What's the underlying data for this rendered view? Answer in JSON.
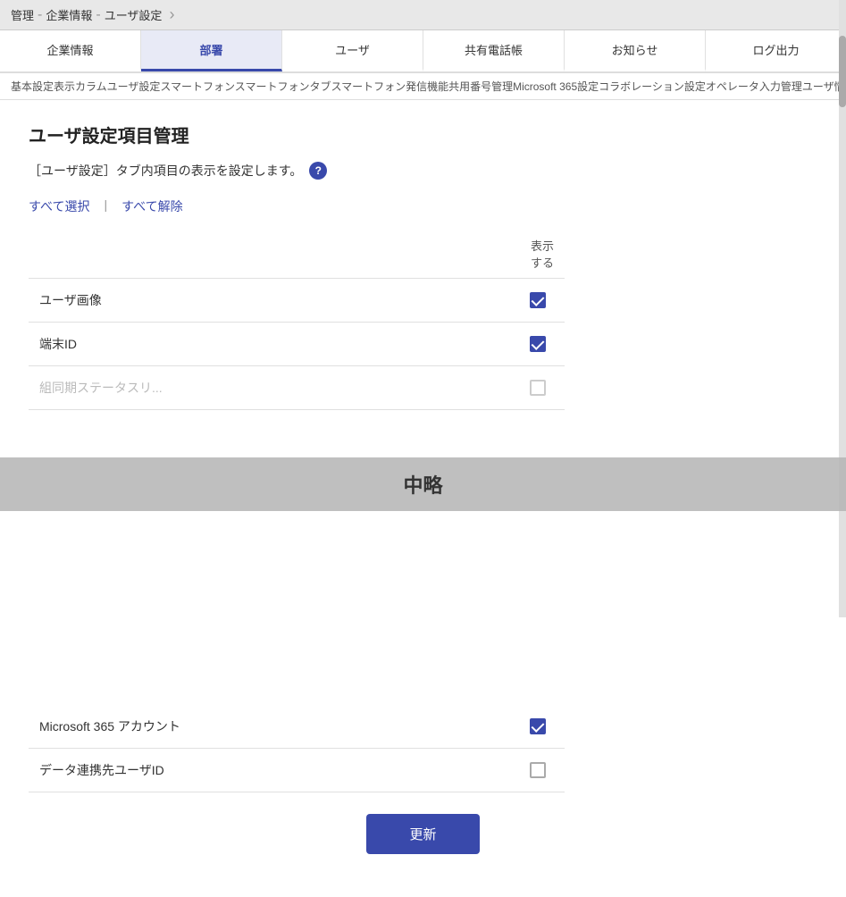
{
  "breadcrumb": {
    "items": [
      "管理",
      "企業情報",
      "ユーザ設定"
    ],
    "separator": "＞"
  },
  "tabs": [
    {
      "id": "company",
      "label": "企業情報",
      "active": false
    },
    {
      "id": "department",
      "label": "部署",
      "active": false
    },
    {
      "id": "user",
      "label": "ユーザ",
      "active": true
    },
    {
      "id": "shared-phonebook",
      "label": "共有電話帳",
      "active": false
    },
    {
      "id": "notification",
      "label": "お知らせ",
      "active": false
    },
    {
      "id": "logout",
      "label": "ログ出力",
      "active": false
    }
  ],
  "sub_tabs": "基本設定表示カラムユーザ設定スマートフォンスマートフォンタブスマートフォン発信機能共用番号管理Microsoft 365設定コラボレーション設定オペレータ入力管理ユーザ情報出力管理エク",
  "page": {
    "title": "ユーザ設定項目管理",
    "description": "［ユーザ設定］タブ内項目の表示を設定します。",
    "help_tooltip": "?",
    "select_all": "すべて選択",
    "deselect_all": "すべて解除",
    "display_header": "表示する",
    "omission_label": "中略",
    "update_button": "更新"
  },
  "settings_rows": [
    {
      "id": "user-image",
      "label": "ユーザ画像",
      "checked": true
    },
    {
      "id": "terminal-id",
      "label": "端末ID",
      "checked": true
    },
    {
      "id": "partial-hidden",
      "label": "組同期ステータスリ...",
      "checked": false,
      "faded": true
    },
    {
      "id": "microsoft365",
      "label": "Microsoft 365 アカウント",
      "checked": true,
      "faded": true
    },
    {
      "id": "data-link-user-id",
      "label": "データ連携先ユーザID",
      "checked": false
    }
  ],
  "colors": {
    "accent": "#3949ab",
    "tab_active_bg": "#e8eaf6",
    "overlay_bg": "rgba(180,180,180,0.85)"
  }
}
